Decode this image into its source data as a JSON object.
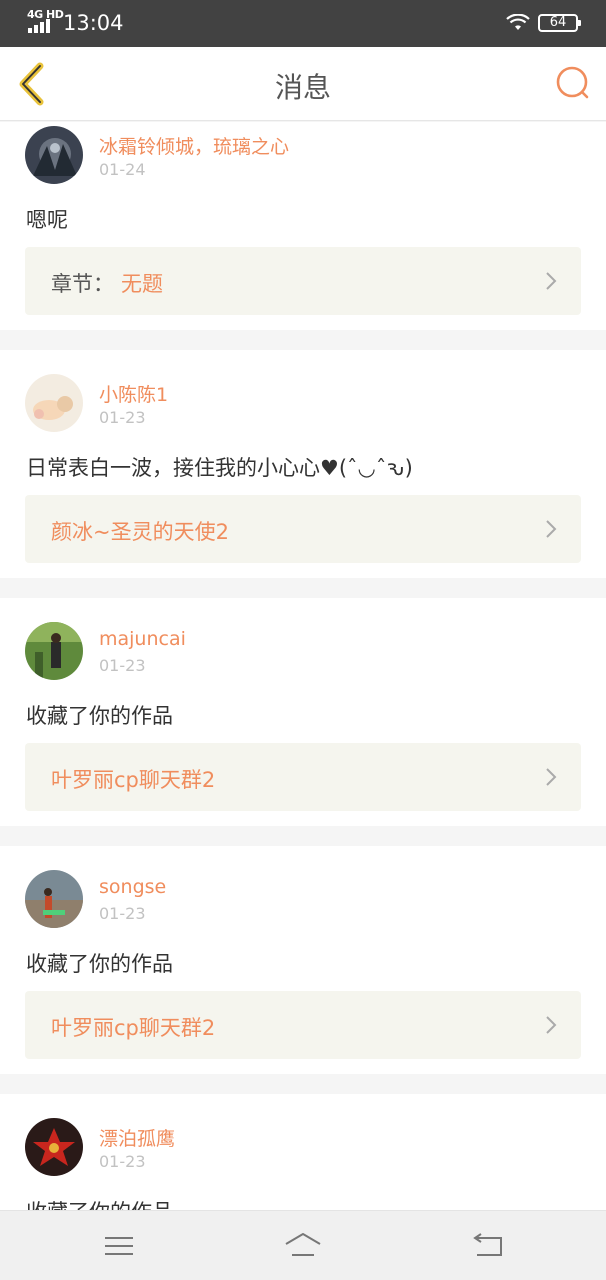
{
  "status": {
    "network": "4G HD",
    "time": "13:04",
    "battery": "64"
  },
  "header": {
    "title": "消息"
  },
  "messages": [
    {
      "user": "冰霜铃倾城，琉璃之心",
      "date": "01-24",
      "text": "嗯呢",
      "work_prefix": "章节：",
      "work_title": "无题"
    },
    {
      "user": "小陈陈1",
      "date": "01-23",
      "text": "日常表白一波，接住我的小心心♥(ˆ◡ˆԅ)",
      "work_prefix": "",
      "work_title": "颜冰~圣灵的天使2"
    },
    {
      "user": "majuncai",
      "date": "01-23",
      "text": "收藏了你的作品",
      "work_prefix": "",
      "work_title": "叶罗丽cp聊天群2"
    },
    {
      "user": "songse",
      "date": "01-23",
      "text": "收藏了你的作品",
      "work_prefix": "",
      "work_title": "叶罗丽cp聊天群2"
    },
    {
      "user": "漂泊孤鹰",
      "date": "01-23",
      "text": "收藏了你的作品",
      "work_prefix": "",
      "work_title": ""
    }
  ],
  "colors": {
    "accent": "#f08d5d",
    "back_icon": "#e8c23a",
    "status_bar": "#424242",
    "card_bg": "#f5f5ee"
  },
  "icons": {
    "back": "chevron-left-icon",
    "search": "search-icon",
    "menu": "menu-icon",
    "home": "home-icon",
    "return": "return-icon"
  }
}
